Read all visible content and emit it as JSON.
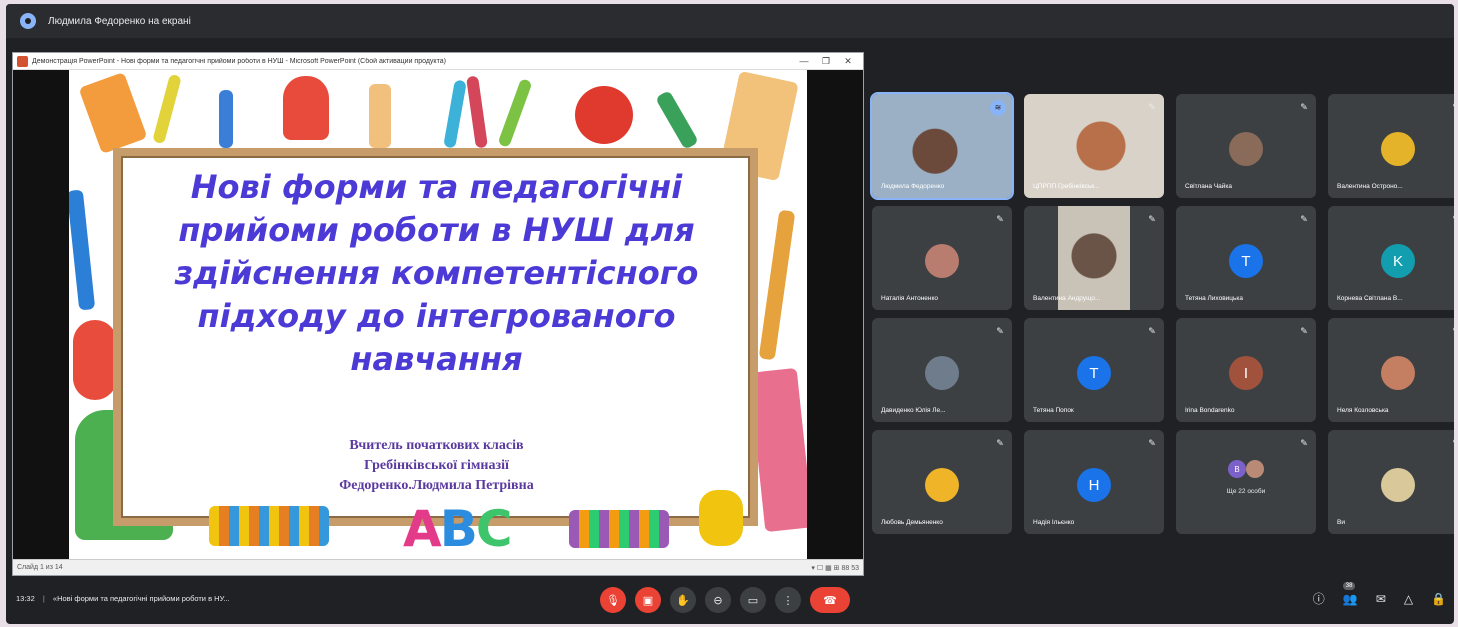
{
  "topbar": {
    "presenter_text": "Людмила Федоренко на екрані"
  },
  "ppt": {
    "window_title": "Демонстрація PowerPoint - Нові форми та педагогічні прийоми роботи в НУШ - Microsoft PowerPoint (Сбой активации продукта)",
    "minimize": "—",
    "restore": "❐",
    "close": "✕",
    "status_left": "Слайд 1 из 14",
    "status_right": "▾  ☐  ▦  ⊞  88 53"
  },
  "slide": {
    "title": "Нові форми та педагогічні прийоми роботи в НУШ для здійснення компетентісного підходу до інтегрованого навчання",
    "subtitle_1": "Вчитель початкових класів",
    "subtitle_2": "Гребінківської гімназії",
    "subtitle_3": "Федоренко.Людмила Петрівна",
    "abc_a": "A",
    "abc_b": "B",
    "abc_c": "C"
  },
  "participants": [
    {
      "name": "Людмила Федоренко",
      "type": "video",
      "speaking": true
    },
    {
      "name": "ЦПРПП Гребінківськ...",
      "type": "video"
    },
    {
      "name": "Світлана Чайка",
      "type": "photo",
      "color": "#8a6b5a"
    },
    {
      "name": "Валентина Остроно...",
      "type": "photo",
      "color": "#e5b32a"
    },
    {
      "name": "Наталія Антоненко",
      "type": "photo",
      "color": "#b87d6f"
    },
    {
      "name": "Валентина Андрущо...",
      "type": "video"
    },
    {
      "name": "Тетяна Лиховицька",
      "type": "letter",
      "letter": "T",
      "color": "#1a73e8"
    },
    {
      "name": "Корнева Світлана В...",
      "type": "letter",
      "letter": "K",
      "color": "#129eaf"
    },
    {
      "name": "Давиденко Юлія Ле...",
      "type": "photo",
      "color": "#6f7c8c"
    },
    {
      "name": "Тетяна Попок",
      "type": "letter",
      "letter": "T",
      "color": "#1a73e8"
    },
    {
      "name": "Irina Bondarenko",
      "type": "letter",
      "letter": "I",
      "color": "#a0523d"
    },
    {
      "name": "Неля Козловська",
      "type": "photo",
      "color": "#c47e62"
    },
    {
      "name": "Любовь Демьяненко",
      "type": "photo",
      "color": "#f0b429"
    },
    {
      "name": "Надія Ільєнко",
      "type": "letter",
      "letter": "H",
      "color": "#1a73e8"
    },
    {
      "name": "",
      "type": "more",
      "more_label": "Ще 22 особи",
      "more_letter": "B"
    },
    {
      "name": "Ви",
      "type": "photo",
      "color": "#d9c89a"
    }
  ],
  "bottom": {
    "time": "13:32",
    "separator": "|",
    "meeting_title": "«Нові форми та педагогічні прийоми роботи в НУ...",
    "participant_count": "38"
  },
  "colors": {
    "bg": "#202124",
    "tile": "#3c4043",
    "accent": "#8ab4f8",
    "danger": "#ea4335",
    "slide_title": "#4b3ad6"
  }
}
